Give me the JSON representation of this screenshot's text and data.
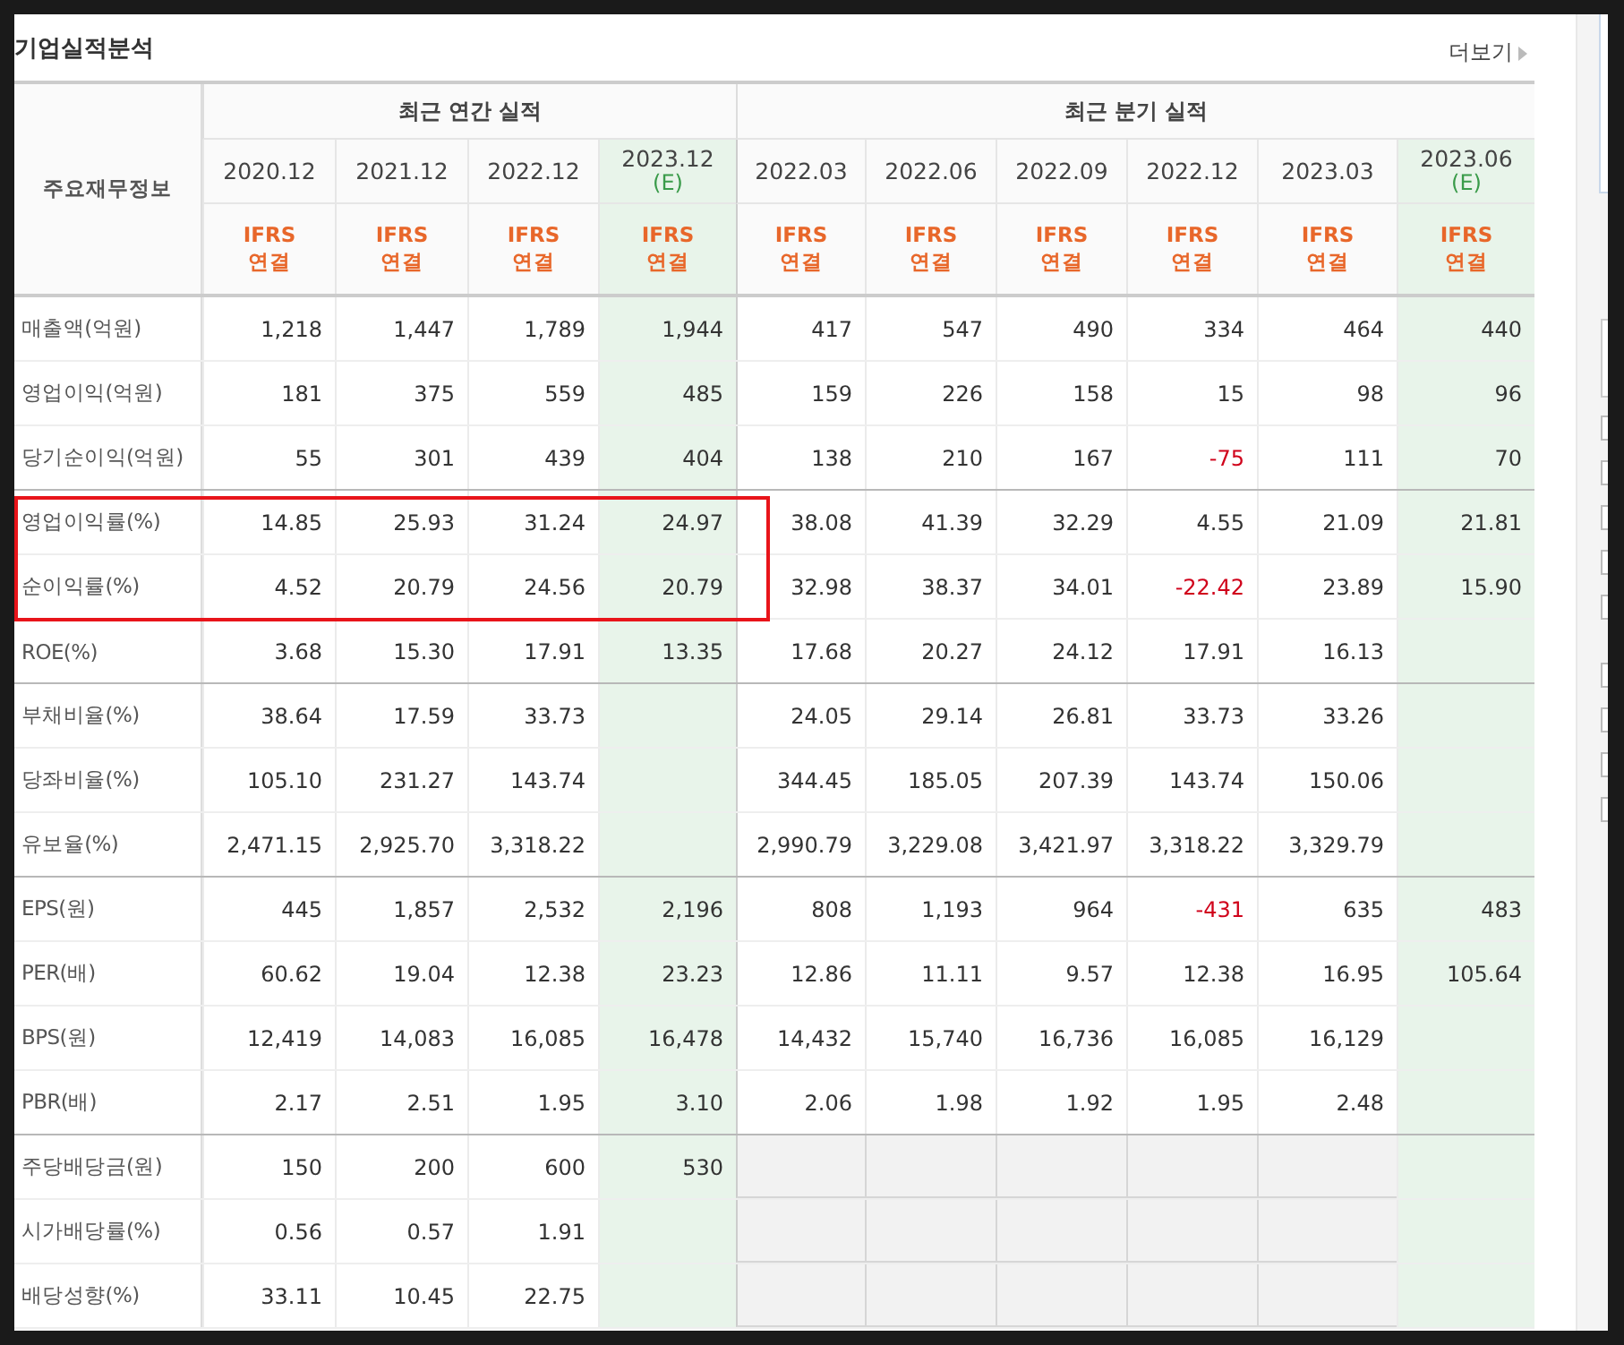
{
  "section": {
    "title": "기업실적분석",
    "more_link": "더보기"
  },
  "table": {
    "corner_header": "주요재무정보",
    "groups": [
      {
        "label": "최근 연간 실적",
        "columns": [
          {
            "period": "2020.12",
            "estimate": false,
            "basis": "IFRS",
            "consolidation": "연결"
          },
          {
            "period": "2021.12",
            "estimate": false,
            "basis": "IFRS",
            "consolidation": "연결"
          },
          {
            "period": "2022.12",
            "estimate": false,
            "basis": "IFRS",
            "consolidation": "연결"
          },
          {
            "period": "2023.12",
            "estimate": true,
            "estimate_mark": "(E)",
            "basis": "IFRS",
            "consolidation": "연결"
          }
        ]
      },
      {
        "label": "최근 분기 실적",
        "columns": [
          {
            "period": "2022.03",
            "estimate": false,
            "basis": "IFRS",
            "consolidation": "연결"
          },
          {
            "period": "2022.06",
            "estimate": false,
            "basis": "IFRS",
            "consolidation": "연결"
          },
          {
            "period": "2022.09",
            "estimate": false,
            "basis": "IFRS",
            "consolidation": "연결"
          },
          {
            "period": "2022.12",
            "estimate": false,
            "basis": "IFRS",
            "consolidation": "연결"
          },
          {
            "period": "2023.03",
            "estimate": false,
            "basis": "IFRS",
            "consolidation": "연결"
          },
          {
            "period": "2023.06",
            "estimate": true,
            "estimate_mark": "(E)",
            "basis": "IFRS",
            "consolidation": "연결"
          }
        ]
      }
    ],
    "rows": [
      {
        "label": "매출액(억원)",
        "divider_after": false,
        "highlighted": false,
        "shaded_quarters": false,
        "annual": [
          {
            "text": "1,218",
            "negative": false
          },
          {
            "text": "1,447",
            "negative": false
          },
          {
            "text": "1,789",
            "negative": false
          },
          {
            "text": "1,944",
            "negative": false
          }
        ],
        "quarterly": [
          {
            "text": "417",
            "negative": false
          },
          {
            "text": "547",
            "negative": false
          },
          {
            "text": "490",
            "negative": false
          },
          {
            "text": "334",
            "negative": false
          },
          {
            "text": "464",
            "negative": false
          },
          {
            "text": "440",
            "negative": false
          }
        ]
      },
      {
        "label": "영업이익(억원)",
        "divider_after": false,
        "highlighted": false,
        "shaded_quarters": false,
        "annual": [
          {
            "text": "181",
            "negative": false
          },
          {
            "text": "375",
            "negative": false
          },
          {
            "text": "559",
            "negative": false
          },
          {
            "text": "485",
            "negative": false
          }
        ],
        "quarterly": [
          {
            "text": "159",
            "negative": false
          },
          {
            "text": "226",
            "negative": false
          },
          {
            "text": "158",
            "negative": false
          },
          {
            "text": "15",
            "negative": false
          },
          {
            "text": "98",
            "negative": false
          },
          {
            "text": "96",
            "negative": false
          }
        ]
      },
      {
        "label": "당기순이익(억원)",
        "divider_after": true,
        "highlighted": false,
        "shaded_quarters": false,
        "annual": [
          {
            "text": "55",
            "negative": false
          },
          {
            "text": "301",
            "negative": false
          },
          {
            "text": "439",
            "negative": false
          },
          {
            "text": "404",
            "negative": false
          }
        ],
        "quarterly": [
          {
            "text": "138",
            "negative": false
          },
          {
            "text": "210",
            "negative": false
          },
          {
            "text": "167",
            "negative": false
          },
          {
            "text": "-75",
            "negative": true
          },
          {
            "text": "111",
            "negative": false
          },
          {
            "text": "70",
            "negative": false
          }
        ]
      },
      {
        "label": "영업이익률(%)",
        "divider_after": false,
        "highlighted": true,
        "shaded_quarters": false,
        "annual": [
          {
            "text": "14.85",
            "negative": false
          },
          {
            "text": "25.93",
            "negative": false
          },
          {
            "text": "31.24",
            "negative": false
          },
          {
            "text": "24.97",
            "negative": false
          }
        ],
        "quarterly": [
          {
            "text": "38.08",
            "negative": false
          },
          {
            "text": "41.39",
            "negative": false
          },
          {
            "text": "32.29",
            "negative": false
          },
          {
            "text": "4.55",
            "negative": false
          },
          {
            "text": "21.09",
            "negative": false
          },
          {
            "text": "21.81",
            "negative": false
          }
        ]
      },
      {
        "label": "순이익률(%)",
        "divider_after": false,
        "highlighted": true,
        "shaded_quarters": false,
        "annual": [
          {
            "text": "4.52",
            "negative": false
          },
          {
            "text": "20.79",
            "negative": false
          },
          {
            "text": "24.56",
            "negative": false
          },
          {
            "text": "20.79",
            "negative": false
          }
        ],
        "quarterly": [
          {
            "text": "32.98",
            "negative": false
          },
          {
            "text": "38.37",
            "negative": false
          },
          {
            "text": "34.01",
            "negative": false
          },
          {
            "text": "-22.42",
            "negative": true
          },
          {
            "text": "23.89",
            "negative": false
          },
          {
            "text": "15.90",
            "negative": false
          }
        ]
      },
      {
        "label": "ROE(%)",
        "divider_after": true,
        "highlighted": false,
        "shaded_quarters": false,
        "annual": [
          {
            "text": "3.68",
            "negative": false
          },
          {
            "text": "15.30",
            "negative": false
          },
          {
            "text": "17.91",
            "negative": false
          },
          {
            "text": "13.35",
            "negative": false
          }
        ],
        "quarterly": [
          {
            "text": "17.68",
            "negative": false
          },
          {
            "text": "20.27",
            "negative": false
          },
          {
            "text": "24.12",
            "negative": false
          },
          {
            "text": "17.91",
            "negative": false
          },
          {
            "text": "16.13",
            "negative": false
          }
        ]
      },
      {
        "label": "부채비율(%)",
        "divider_after": false,
        "highlighted": false,
        "shaded_quarters": false,
        "annual": [
          {
            "text": "38.64",
            "negative": false
          },
          {
            "text": "17.59",
            "negative": false
          },
          {
            "text": "33.73",
            "negative": false
          }
        ],
        "quarterly": [
          {
            "text": "24.05",
            "negative": false
          },
          {
            "text": "29.14",
            "negative": false
          },
          {
            "text": "26.81",
            "negative": false
          },
          {
            "text": "33.73",
            "negative": false
          },
          {
            "text": "33.26",
            "negative": false
          }
        ]
      },
      {
        "label": "당좌비율(%)",
        "divider_after": false,
        "highlighted": false,
        "shaded_quarters": false,
        "annual": [
          {
            "text": "105.10",
            "negative": false
          },
          {
            "text": "231.27",
            "negative": false
          },
          {
            "text": "143.74",
            "negative": false
          }
        ],
        "quarterly": [
          {
            "text": "344.45",
            "negative": false
          },
          {
            "text": "185.05",
            "negative": false
          },
          {
            "text": "207.39",
            "negative": false
          },
          {
            "text": "143.74",
            "negative": false
          },
          {
            "text": "150.06",
            "negative": false
          }
        ]
      },
      {
        "label": "유보율(%)",
        "divider_after": true,
        "highlighted": false,
        "shaded_quarters": false,
        "annual": [
          {
            "text": "2,471.15",
            "negative": false
          },
          {
            "text": "2,925.70",
            "negative": false
          },
          {
            "text": "3,318.22",
            "negative": false
          }
        ],
        "quarterly": [
          {
            "text": "2,990.79",
            "negative": false
          },
          {
            "text": "3,229.08",
            "negative": false
          },
          {
            "text": "3,421.97",
            "negative": false
          },
          {
            "text": "3,318.22",
            "negative": false
          },
          {
            "text": "3,329.79",
            "negative": false
          }
        ]
      },
      {
        "label": "EPS(원)",
        "divider_after": false,
        "highlighted": false,
        "shaded_quarters": false,
        "annual": [
          {
            "text": "445",
            "negative": false
          },
          {
            "text": "1,857",
            "negative": false
          },
          {
            "text": "2,532",
            "negative": false
          },
          {
            "text": "2,196",
            "negative": false
          }
        ],
        "quarterly": [
          {
            "text": "808",
            "negative": false
          },
          {
            "text": "1,193",
            "negative": false
          },
          {
            "text": "964",
            "negative": false
          },
          {
            "text": "-431",
            "negative": true
          },
          {
            "text": "635",
            "negative": false
          },
          {
            "text": "483",
            "negative": false
          }
        ]
      },
      {
        "label": "PER(배)",
        "divider_after": false,
        "highlighted": false,
        "shaded_quarters": false,
        "annual": [
          {
            "text": "60.62",
            "negative": false
          },
          {
            "text": "19.04",
            "negative": false
          },
          {
            "text": "12.38",
            "negative": false
          },
          {
            "text": "23.23",
            "negative": false
          }
        ],
        "quarterly": [
          {
            "text": "12.86",
            "negative": false
          },
          {
            "text": "11.11",
            "negative": false
          },
          {
            "text": "9.57",
            "negative": false
          },
          {
            "text": "12.38",
            "negative": false
          },
          {
            "text": "16.95",
            "negative": false
          },
          {
            "text": "105.64",
            "negative": false
          }
        ]
      },
      {
        "label": "BPS(원)",
        "divider_after": false,
        "highlighted": false,
        "shaded_quarters": false,
        "annual": [
          {
            "text": "12,419",
            "negative": false
          },
          {
            "text": "14,083",
            "negative": false
          },
          {
            "text": "16,085",
            "negative": false
          },
          {
            "text": "16,478",
            "negative": false
          }
        ],
        "quarterly": [
          {
            "text": "14,432",
            "negative": false
          },
          {
            "text": "15,740",
            "negative": false
          },
          {
            "text": "16,736",
            "negative": false
          },
          {
            "text": "16,085",
            "negative": false
          },
          {
            "text": "16,129",
            "negative": false
          }
        ]
      },
      {
        "label": "PBR(배)",
        "divider_after": true,
        "highlighted": false,
        "shaded_quarters": false,
        "annual": [
          {
            "text": "2.17",
            "negative": false
          },
          {
            "text": "2.51",
            "negative": false
          },
          {
            "text": "1.95",
            "negative": false
          },
          {
            "text": "3.10",
            "negative": false
          }
        ],
        "quarterly": [
          {
            "text": "2.06",
            "negative": false
          },
          {
            "text": "1.98",
            "negative": false
          },
          {
            "text": "1.92",
            "negative": false
          },
          {
            "text": "1.95",
            "negative": false
          },
          {
            "text": "2.48",
            "negative": false
          }
        ]
      },
      {
        "label": "주당배당금(원)",
        "divider_after": false,
        "highlighted": false,
        "shaded_quarters": true,
        "annual": [
          {
            "text": "150",
            "negative": false
          },
          {
            "text": "200",
            "negative": false
          },
          {
            "text": "600",
            "negative": false
          },
          {
            "text": "530",
            "negative": false
          }
        ]
      },
      {
        "label": "시가배당률(%)",
        "divider_after": false,
        "highlighted": false,
        "shaded_quarters": true,
        "annual": [
          {
            "text": "0.56",
            "negative": false
          },
          {
            "text": "0.57",
            "negative": false
          },
          {
            "text": "1.91",
            "negative": false
          }
        ]
      },
      {
        "label": "배당성향(%)",
        "divider_after": false,
        "highlighted": false,
        "shaded_quarters": true,
        "annual": [
          {
            "text": "33.11",
            "negative": false
          },
          {
            "text": "10.45",
            "negative": false
          },
          {
            "text": "22.75",
            "negative": false
          }
        ]
      }
    ]
  },
  "side_panel": {
    "checkboxes": [
      {
        "checked": false
      },
      {
        "checked": false
      },
      {
        "checked": false
      },
      {
        "checked": false
      },
      {
        "checked": false
      },
      {
        "checked": false
      },
      {
        "checked": false
      },
      {
        "checked": false
      },
      {
        "checked": false
      }
    ]
  }
}
